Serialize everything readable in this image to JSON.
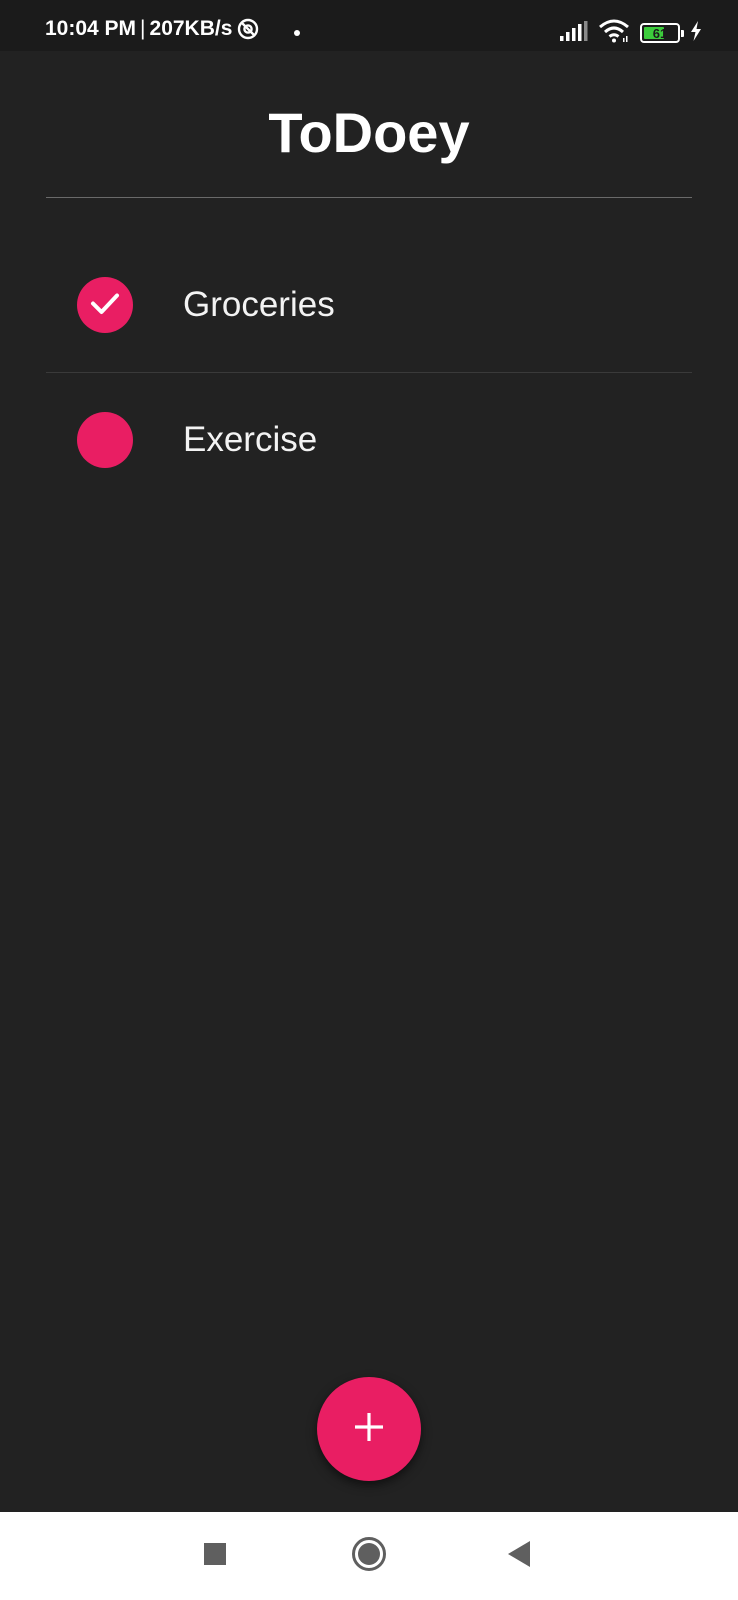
{
  "status_bar": {
    "time": "10:04 PM",
    "separator": "|",
    "network_speed": "207KB/s",
    "battery_level": "61",
    "battery_fraction": 0.61,
    "icons": [
      "at-sign-icon",
      "notification-dot-icon",
      "cellular-signal-icon",
      "wifi-icon",
      "battery-icon",
      "charging-bolt-icon"
    ]
  },
  "header": {
    "title": "ToDoey"
  },
  "tasks": [
    {
      "label": "Groceries",
      "done": true,
      "icon": "checkmark-icon"
    },
    {
      "label": "Exercise",
      "done": false
    }
  ],
  "fab": {
    "icon": "plus-icon"
  },
  "nav_bar": {
    "icons": [
      "recents-square-icon",
      "home-circle-icon",
      "back-triangle-icon"
    ]
  },
  "colors": {
    "background": "#222222",
    "status_bar": "#1b1b1b",
    "accent": "#e91e63",
    "text": "#ffffff",
    "nav_bar": "#ffffff",
    "battery_green": "#3ccc3c"
  }
}
